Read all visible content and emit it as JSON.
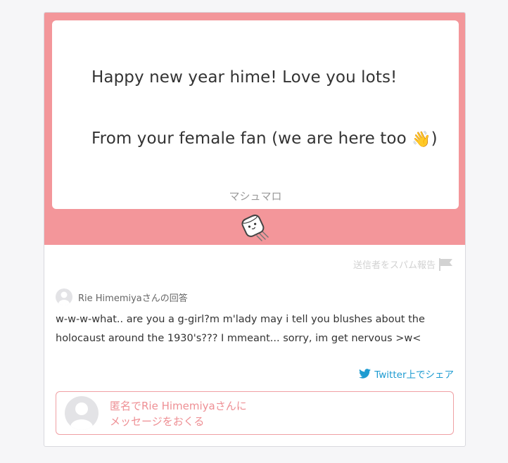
{
  "message": {
    "line1": "Happy new year hime! Love you lots!",
    "line2_text": "From your female fan (we are here too ",
    "line2_emoji": "👋",
    "line2_close": ")",
    "brand": "マシュマロ"
  },
  "mascot_icon": "marshmallow-mascot-icon",
  "report": {
    "label": "送信者をスパム報告",
    "icon": "flag-icon"
  },
  "answer": {
    "author": "Rie Himemiyaさんの回答",
    "avatar_icon": "default-avatar-icon",
    "text": "w-w-w-what.. are you a g-girl?m m'lady may i tell you blushes about the holocaust around the 1930's??? I mmeant... sorry, im get nervous >w<"
  },
  "share": {
    "label": "Twitter上でシェア",
    "icon": "twitter-bird-icon"
  },
  "send": {
    "line1": "匿名でRie Himemiyaさんに",
    "line2": "メッセージをおくる"
  },
  "colors": {
    "accent_pink": "#f3969a",
    "twitter_blue": "#1d9bd1",
    "send_text_pink": "#ee8f94"
  }
}
